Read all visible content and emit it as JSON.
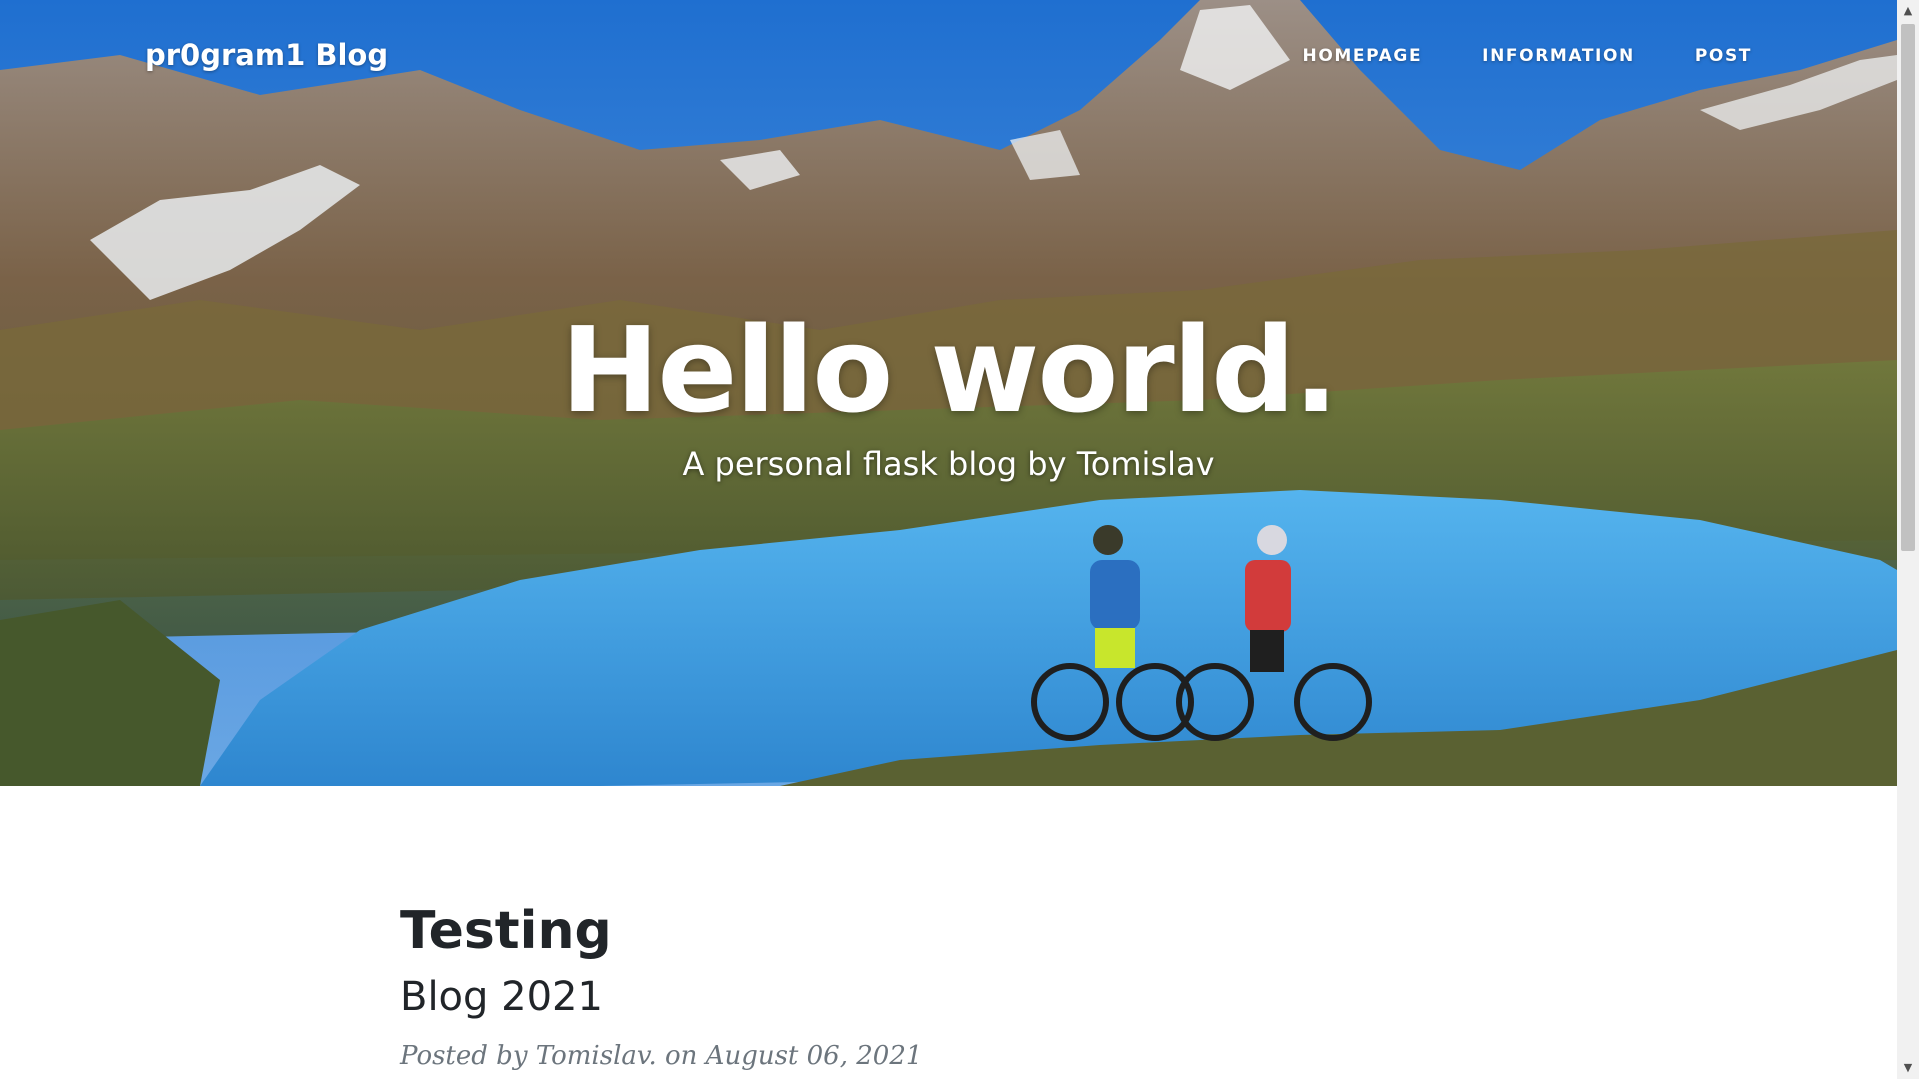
{
  "header": {
    "brand": "pr0gram1 Blog",
    "nav": [
      {
        "label": "Homepage"
      },
      {
        "label": "Information"
      },
      {
        "label": "Post"
      }
    ]
  },
  "hero": {
    "title": "Hello world.",
    "subtitle": "A personal flask blog by Tomislav",
    "image": "mountain-lake-cyclists-photo"
  },
  "posts": [
    {
      "title": "Testing",
      "subtitle": "Blog 2021",
      "meta": "Posted by Tomislav. on August 06, 2021"
    }
  ],
  "scrollbar": {
    "up_icon": "▲",
    "down_icon": "▼"
  },
  "colors": {
    "text_dark": "#212529",
    "meta_gray": "#6c757d",
    "sky": "#2f7fd6",
    "lake": "#3f9fe0"
  }
}
